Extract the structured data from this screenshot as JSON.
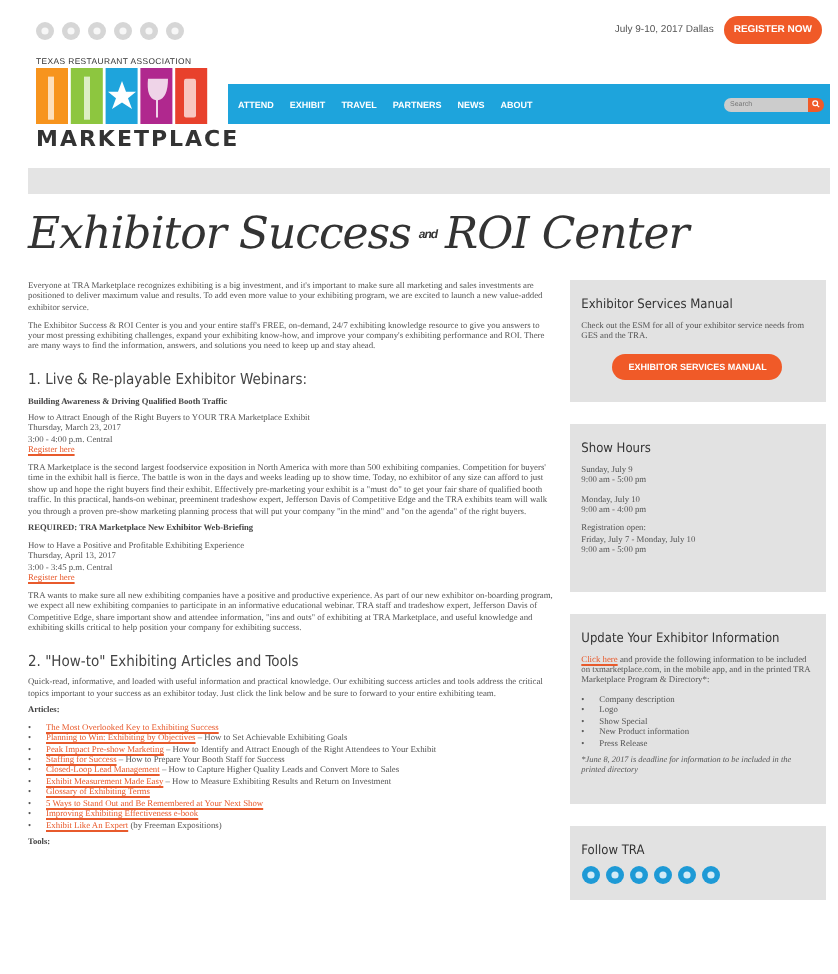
{
  "top_bar": {
    "event_date": "July 9-10, 2017 Dallas",
    "register_button": "REGISTER NOW"
  },
  "logo": {
    "tagline": "TEXAS RESTAURANT ASSOCIATION",
    "wordmark": "MARKETPLACE"
  },
  "nav": {
    "items": [
      "ATTEND",
      "EXHIBIT",
      "TRAVEL",
      "PARTNERS",
      "NEWS",
      "ABOUT"
    ],
    "search": {
      "placeholder": "Search"
    }
  },
  "page_title": {
    "before": "Exhibitor Success",
    "joiner": "and",
    "after": "ROI Center"
  },
  "content": [
    {
      "kind": "para",
      "text": "Everyone at TRA Marketplace recognizes exhibiting is a big investment, and it's important to make sure all marketing and sales investments are positioned to deliver maximum value and results. To add even more value to your exhibiting program, we are excited to launch a new value-added exhibitor service."
    },
    {
      "kind": "para",
      "text": "The Exhibitor Success & ROI Center is you and your entire staff's FREE, on-demand, 24/7 exhibiting knowledge resource to give you answers to your most pressing exhibiting challenges, expand your exhibiting know-how, and improve your company's exhibiting performance and ROI. There are many ways to find the information, answers, and solutions you need to keep up and stay ahead."
    },
    {
      "kind": "heading",
      "text": "1. Live & Re-playable Exhibitor Webinars:"
    },
    {
      "kind": "bold",
      "text": "Building Awareness & Driving Qualified Booth Traffic"
    },
    {
      "kind": "lines",
      "lines": [
        "How to Attract Enough of the Right Buyers to YOUR TRA Marketplace Exhibit",
        "Thursday, March 23, 2017",
        "3:00 - 4:00 p.m. Central"
      ],
      "link": "Register here"
    },
    {
      "kind": "para",
      "text": "TRA Marketplace is the second largest foodservice exposition in North America with more than 500 exhibiting companies. Competition for buyers' time in the exhibit hall is fierce. The battle is won in the days and weeks leading up to show time. Today, no exhibitor of any size can afford to just show up and hope the right buyers find their exhibit. Effectively pre-marketing your exhibit is a \"must do\" to get your fair share of qualified booth traffic. In this practical, hands-on webinar, preeminent tradeshow expert, Jefferson Davis of Competitive Edge and the TRA exhibits team will walk you through a proven pre-show marketing planning process that will put your company \"in the mind\" and \"on the agenda\" of the right buyers."
    },
    {
      "kind": "bold",
      "text": "REQUIRED: TRA Marketplace New Exhibitor Web-Briefing"
    },
    {
      "kind": "lines",
      "lines": [
        "How to Have a Positive and Profitable Exhibiting Experience",
        "Thursday, April 13, 2017",
        "3:00 - 3:45 p.m. Central"
      ],
      "link": "Register here"
    },
    {
      "kind": "para",
      "text": "TRA wants to make sure all new exhibiting companies have a positive and productive experience. As part of our new exhibitor on-boarding program, we expect all new exhibiting companies to participate in an informative educational webinar. TRA staff and tradeshow expert, Jefferson Davis of Competitive Edge, share important show and attendee information, \"ins and outs\" of exhibiting at TRA Marketplace, and useful knowledge and exhibiting skills critical to help position your company for exhibiting success."
    },
    {
      "kind": "heading",
      "text": "2. \"How-to\" Exhibiting Articles and Tools"
    },
    {
      "kind": "para",
      "text": "Quick-read, informative, and loaded with useful information and practical knowledge. Our exhibiting success articles and tools address the critical topics important to your success as an exhibitor today. Just click the link below and be sure to forward to your entire exhibiting team."
    },
    {
      "kind": "bold",
      "text": "Articles:"
    },
    {
      "kind": "list",
      "marker": "•",
      "items": [
        {
          "link": "The Most Overlooked Key to Exhibiting Success"
        },
        {
          "link": "Planning to Win: Exhibiting by Objectives",
          "text": "– How to Set Achievable Exhibiting Goals"
        },
        {
          "link": "Peak Impact Pre-show Marketing",
          "text": "– How to Identify and Attract Enough of the Right Attendees to Your Exhibit"
        },
        {
          "link": "Staffing for Success",
          "text": "– How to Prepare Your Booth Staff for Success"
        },
        {
          "link": "Closed-Loop Lead Management",
          "text": "– How to Capture Higher Quality Leads and Convert More to Sales"
        },
        {
          "link": "Exhibit Measurement Made Easy",
          "text": "– How to Measure Exhibiting Results and Return on Investment"
        },
        {
          "link": "Glossary of Exhibiting Terms"
        },
        {
          "link": "5 Ways to Stand Out and Be Remembered at Your Next Show"
        },
        {
          "link": "Improving Exhibiting Effectiveness e-book"
        },
        {
          "link": "Exhibit Like An Expert",
          "text": "(by Freeman Expositions)"
        }
      ]
    },
    {
      "kind": "bold",
      "text": "Tools:"
    }
  ],
  "sidebar": [
    {
      "kind": "manual",
      "title": "Exhibitor Services Manual",
      "text": "Check out the ESM for all of your exhibitor service needs from GES and the TRA.",
      "button": "EXHIBITOR SERVICES MANUAL"
    },
    {
      "kind": "hours",
      "title": "Show Hours",
      "groups": [
        [
          "Sunday, July 9",
          "9:00 am - 5:00 pm"
        ],
        [
          "Monday, July 10",
          "9:00 am - 4:00 pm"
        ],
        [
          "Registration open:",
          "Friday, July 7 - Monday, July 10",
          "9:00 am - 5:00 pm"
        ]
      ]
    },
    {
      "kind": "update",
      "title": "Update Your Exhibitor Information",
      "link": "Click here",
      "text": "and provide the following information to be included on txmarketplace.com, in the mobile app, and in the printed TRA Marketplace Program & Directory*:",
      "marker": "•",
      "items": [
        "Company description",
        "Logo",
        "Show Special",
        "New Product information",
        "Press Release"
      ],
      "note": "*June 8, 2017 is deadline for information to be included in the printed directory"
    },
    {
      "kind": "follow",
      "title": "Follow TRA"
    }
  ]
}
